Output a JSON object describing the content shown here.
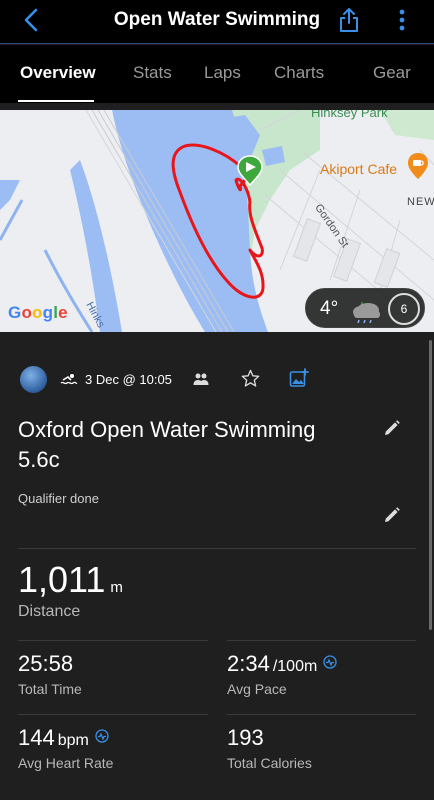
{
  "header": {
    "title": "Open Water Swimming"
  },
  "tabs": [
    {
      "label": "Overview",
      "active": true
    },
    {
      "label": "Stats"
    },
    {
      "label": "Laps"
    },
    {
      "label": "Charts"
    },
    {
      "label": "Gear"
    }
  ],
  "map": {
    "labels": {
      "park": "Hinksey Park",
      "cafe": "Akiport Cafe",
      "street": "Gordon St",
      "new": "NEW",
      "road": "Hinks"
    },
    "attribution": "Google",
    "weather": {
      "temperature": "4°",
      "wind": "6"
    },
    "route_color": "#e8161b"
  },
  "activity": {
    "date": "3 Dec @ 10:05",
    "name": "Oxford Open Water Swimming 5.6c",
    "description": "Qualifier done"
  },
  "stats": {
    "distance": {
      "value": "1,011",
      "unit": "m",
      "label": "Distance"
    },
    "total_time": {
      "value": "25:58",
      "label": "Total Time"
    },
    "avg_pace": {
      "value": "2:34",
      "unit": "/100m",
      "label": "Avg Pace"
    },
    "avg_heart_rate": {
      "value": "144",
      "unit": "bpm",
      "label": "Avg Heart Rate"
    },
    "total_calories": {
      "value": "193",
      "label": "Total Calories"
    }
  },
  "colors": {
    "accent": "#3a8fe8",
    "background": "#1f1f1f",
    "header": "#000000"
  }
}
